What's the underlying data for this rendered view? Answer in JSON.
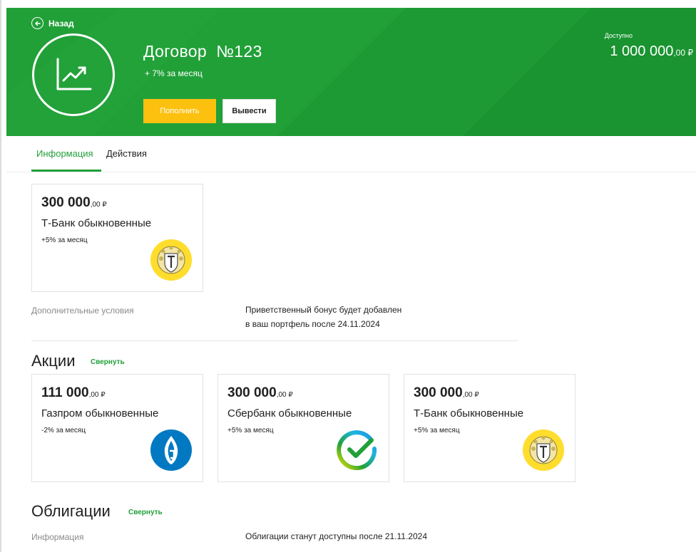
{
  "header": {
    "back_label": "Назад",
    "title": "Договор  №123",
    "subtitle": "+ 7% за месяц",
    "deposit_label": "Пополнить",
    "withdraw_label": "Вывести",
    "available_label": "Доступно",
    "available_amount": "1 000 000",
    "available_cents": ",00 ₽"
  },
  "tabs": [
    {
      "label": "Информация",
      "active": true
    },
    {
      "label": "Действия",
      "active": false
    }
  ],
  "featured_card": {
    "amount": "300 000",
    "cents": ",00 ₽",
    "name": "Т-Банк обыкновенные",
    "change": "+5% за месяц",
    "logo": "tbank-logo"
  },
  "conditions": {
    "label": "Дополнительные условия",
    "line1": "Приветственный бонус будет добавлен",
    "line2": "в ваш портфель после 24.11.2024"
  },
  "stocks": {
    "title": "Акции",
    "collapse_label": "Свернуть",
    "items": [
      {
        "amount": "111 000",
        "cents": ",00 ₽",
        "name": "Газпром обыкновенные",
        "change": "-2% за месяц",
        "logo": "gazprom-logo"
      },
      {
        "amount": "300 000",
        "cents": ",00 ₽",
        "name": "Сбербанк обыкновенные",
        "change": "+5% за месяц",
        "logo": "sber-logo"
      },
      {
        "amount": "300 000",
        "cents": ",00 ₽",
        "name": "Т-Банк обыкновенные",
        "change": "+5% за месяц",
        "logo": "tbank-logo"
      }
    ]
  },
  "bonds": {
    "title": "Облигации",
    "collapse_label": "Свернуть",
    "info_label": "Информация",
    "info_value": "Облигации станут доступны после 21.11.2024"
  },
  "colors": {
    "brand_green": "#21a038",
    "accent_yellow": "#fcc00f",
    "gazprom_blue": "#0079c2",
    "tbank_yellow": "#ffdd2d"
  }
}
